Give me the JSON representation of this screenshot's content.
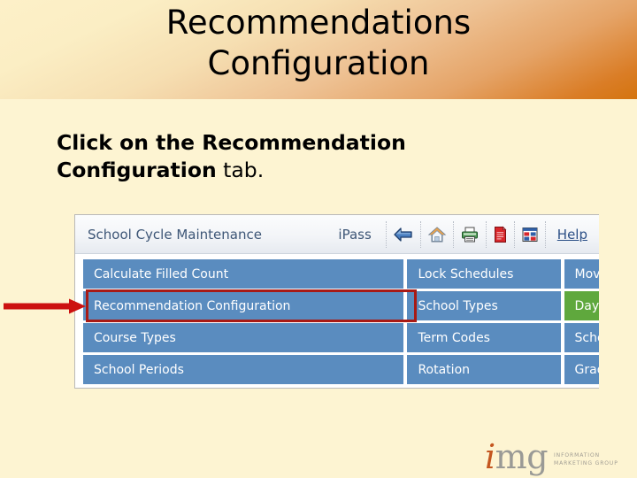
{
  "slide": {
    "title": "Recommendations\nConfiguration",
    "instruction_bold": "Click on the Recommendation Configuration",
    "instruction_normal": " tab."
  },
  "colors": {
    "banner_light": "#fdf0c8",
    "banner_dark": "#d4740e",
    "page_background": "#fdf4d2",
    "menu_blue": "#5a8cbf",
    "menu_green": "#5fa83d",
    "highlight_red": "#a81a15",
    "app_title_blue": "#3d5676"
  },
  "app": {
    "title": "School Cycle Maintenance",
    "toolbar": {
      "ipass_label": "iPass",
      "help_label": "Help",
      "icons": [
        {
          "name": "back-arrow-icon",
          "label": "Back"
        },
        {
          "name": "home-icon",
          "label": "Home"
        },
        {
          "name": "printer-icon",
          "label": "Print"
        },
        {
          "name": "document-icon",
          "label": "Document"
        },
        {
          "name": "report-grid-icon",
          "label": "Report"
        }
      ]
    },
    "menu_rows": [
      {
        "col_a": {
          "label": "Calculate Filled Count",
          "state": "normal",
          "highlighted": false
        },
        "col_b": {
          "label": "Lock Schedules",
          "state": "normal"
        },
        "col_c": {
          "label": "Move",
          "state": "normal"
        }
      },
      {
        "col_a": {
          "label": "Recommendation Configuration",
          "state": "normal",
          "highlighted": true
        },
        "col_b": {
          "label": "School Types",
          "state": "normal"
        },
        "col_c": {
          "label": "Day ",
          "state": "green"
        }
      },
      {
        "col_a": {
          "label": "Course Types",
          "state": "normal",
          "highlighted": false
        },
        "col_b": {
          "label": "Term Codes",
          "state": "normal"
        },
        "col_c": {
          "label": "Scho",
          "state": "normal"
        }
      },
      {
        "col_a": {
          "label": "School Periods",
          "state": "normal",
          "highlighted": false
        },
        "col_b": {
          "label": "Rotation",
          "state": "normal"
        },
        "col_c": {
          "label": "Grad",
          "state": "normal"
        }
      }
    ]
  },
  "logo": {
    "mark_accent": "i",
    "mark_rest": "mg",
    "tagline": "INFORMATION\nMARKETING GROUP"
  }
}
